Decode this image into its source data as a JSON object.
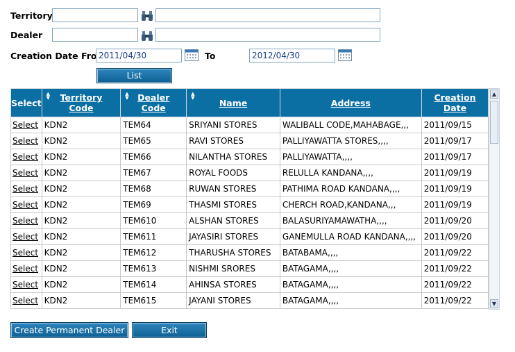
{
  "filters": {
    "territory_label": "Territory",
    "dealer_label": "Dealer",
    "creation_date_from_label": "Creation Date From",
    "to_label": "To",
    "date_from": "2011/04/30",
    "date_to": "2012/04/30",
    "list_label": "List"
  },
  "table": {
    "headers": {
      "select": "Select",
      "territory_code_1": "Territory",
      "territory_code_2": "Code",
      "dealer_code_1": "Dealer",
      "dealer_code_2": "Code",
      "name": "Name",
      "address": "Address",
      "creation_date_1": "Creation",
      "creation_date_2": "Date"
    },
    "select_link": "Select",
    "rows": [
      {
        "territory": "KDN2",
        "dealer": "TEM64",
        "name": "SRIYANI STORES",
        "address": "WALIBALL CODE,MAHABAGE,,,",
        "date": "2011/09/15"
      },
      {
        "territory": "KDN2",
        "dealer": "TEM65",
        "name": "RAVI STORES",
        "address": "PALLIYAWATTA STORES,,,,",
        "date": "2011/09/17"
      },
      {
        "territory": "KDN2",
        "dealer": "TEM66",
        "name": "NILANTHA STORES",
        "address": "PALLIYAWATTA,,,,",
        "date": "2011/09/17"
      },
      {
        "territory": "KDN2",
        "dealer": "TEM67",
        "name": "ROYAL FOODS",
        "address": "RELULLA KANDANA,,,,",
        "date": "2011/09/19"
      },
      {
        "territory": "KDN2",
        "dealer": "TEM68",
        "name": "RUWAN STORES",
        "address": "PATHIMA ROAD KANDANA,,,,",
        "date": "2011/09/19"
      },
      {
        "territory": "KDN2",
        "dealer": "TEM69",
        "name": "THASMI STORES",
        "address": "CHERCH ROAD,KANDANA,,,",
        "date": "2011/09/19"
      },
      {
        "territory": "KDN2",
        "dealer": "TEM610",
        "name": "ALSHAN STORES",
        "address": "BALASURIYAMAWATHA,,,,",
        "date": "2011/09/20"
      },
      {
        "territory": "KDN2",
        "dealer": "TEM611",
        "name": "JAYASIRI STORES",
        "address": "GANEMULLA ROAD KANDANA,,,,",
        "date": "2011/09/20"
      },
      {
        "territory": "KDN2",
        "dealer": "TEM612",
        "name": "THARUSHA STORES",
        "address": "BATABAMA,,,,",
        "date": "2011/09/22"
      },
      {
        "territory": "KDN2",
        "dealer": "TEM613",
        "name": "NISHMI SRORES",
        "address": "BATAGAMA,,,,",
        "date": "2011/09/22"
      },
      {
        "territory": "KDN2",
        "dealer": "TEM614",
        "name": "AHINSA STORES",
        "address": "BATAGAMA,,,,",
        "date": "2011/09/22"
      },
      {
        "territory": "KDN2",
        "dealer": "TEM615",
        "name": "JAYANI STORES",
        "address": "BATAGAMA,,,,",
        "date": "2011/09/22"
      }
    ]
  },
  "footer": {
    "create_label": "Create Permanent Dealer",
    "exit_label": "Exit"
  },
  "colors": {
    "header_bg": "#0b6fa4",
    "button_bg": "#0d5f93",
    "date_text": "#1d3f8a"
  }
}
